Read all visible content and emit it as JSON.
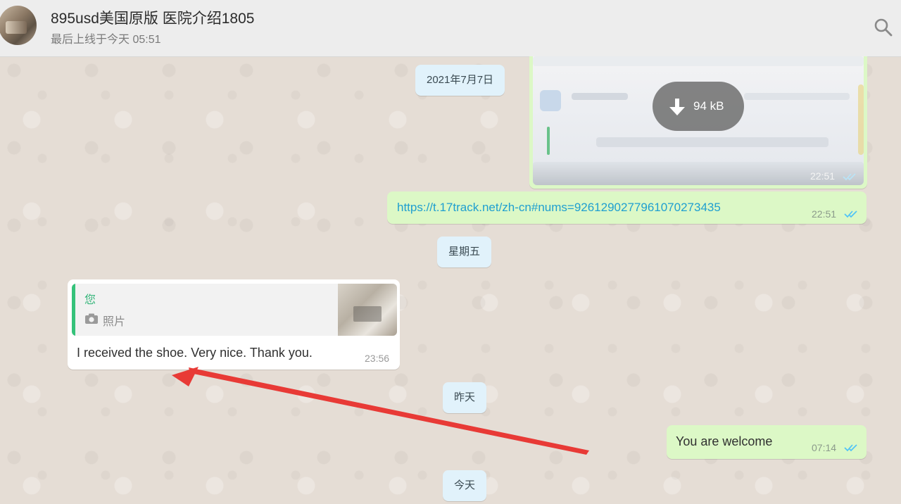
{
  "header": {
    "title": "895usd美国原版 医院介绍1805",
    "subtitle": "最后上线于今天 05:51",
    "search_icon": "search-icon"
  },
  "messages": {
    "date_1": "2021年7月7日",
    "image_download_size": "94 kB",
    "image_time": "22:51",
    "link_text": "https://t.17track.net/zh-cn#nums=92612902779610702734​35",
    "link_time": "22:51",
    "date_2": "星期五",
    "reply_quote_author": "您",
    "reply_quote_text": "照片",
    "reply_text": "I received the shoe. Very nice. Thank you.",
    "reply_time": "23:56",
    "date_3": "昨天",
    "welcome_text": "You are welcome",
    "welcome_time": "07:14",
    "date_4": "今天"
  },
  "colors": {
    "header_bg": "#ededed",
    "outgoing_bubble": "#dcf8c6",
    "incoming_bubble": "#ffffff",
    "date_chip": "#e1f2fb",
    "link": "#1f9fd0",
    "read_ticks": "#4fc3f7",
    "quote_bar": "#35c27a",
    "annotation_arrow": "#e83a36"
  }
}
